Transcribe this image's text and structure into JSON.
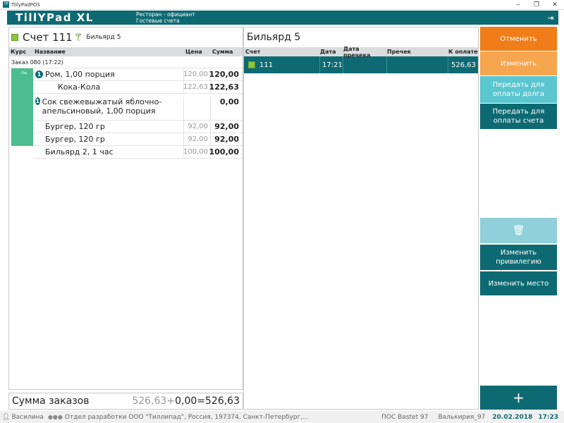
{
  "window": {
    "title": "TillyPadPOS",
    "min": "‒",
    "restore": "❐",
    "close": "✕"
  },
  "header": {
    "logo": "TillYPad XL",
    "line1": "Ресторан - официант",
    "line2": "Гостевые счета",
    "logout_icon": "logout-icon"
  },
  "account": {
    "title": "Счет 111",
    "location": "Бильярд 5",
    "columns": {
      "course": "Курс",
      "name": "Название",
      "price": "Цена",
      "sum": "Сумма"
    },
    "order": "Заказ 080 (17:22)",
    "course_tag": "Ош",
    "items": [
      {
        "badge": "1",
        "name": "Ром, 1,00 порция",
        "price": "120,00",
        "sum": "120,00"
      },
      {
        "badge": "",
        "name": "Кока-Кола",
        "price": "122,63",
        "sum": "122,63"
      },
      {
        "badge": "1",
        "name": "Сок свежевыжатый яблочно-апельсиновый, 1,00 порция",
        "price": "",
        "sum": "0,00"
      },
      {
        "badge": "",
        "name": "Бургер, 120 гр",
        "price": "92,00",
        "sum": "92,00"
      },
      {
        "badge": "",
        "name": "Бургер, 120 гр",
        "price": "92,00",
        "sum": "92,00"
      },
      {
        "badge": "",
        "name": "Бильярд 2, 1 час",
        "price": "100,00",
        "sum": "100,00"
      }
    ]
  },
  "total": {
    "label": "Сумма заказов",
    "a": "526,63",
    "plus": "+",
    "b": "0,00",
    "eq": "=",
    "result": "526,63"
  },
  "table": {
    "title": "Бильярд 5",
    "columns": {
      "account": "Счет",
      "date": "Дата",
      "precheck_date": "Дата пречека",
      "precheck": "Пречек",
      "to_pay": "К оплате"
    },
    "rows": [
      {
        "account": "111",
        "date": "17:21",
        "precheck_date": "",
        "precheck": "",
        "to_pay": "526,63"
      }
    ]
  },
  "buttons": {
    "cancel": "Отменить",
    "change": "Изменить",
    "debt": "Передать для оплаты долга",
    "bill": "Передать для оплаты счета",
    "delete_icon": "trash-icon",
    "privilege": "Изменить привилегию",
    "place": "Изменить место",
    "add": "+"
  },
  "status": {
    "user": "Василина",
    "developer": "Отдел разработки ООО \"Тиллипад\", Россия, 197374, Санкт-Петербург,...",
    "pos": "ПОС Bastet 97",
    "server": "Валькирия_97",
    "date": "20.02.2018",
    "time": "17:23"
  },
  "colors": {
    "teal": "#0e6a72",
    "orange": "#f07d18",
    "light_orange": "#f6a64f",
    "cyan": "#5bc6cf",
    "green": "#4cbd8d"
  }
}
